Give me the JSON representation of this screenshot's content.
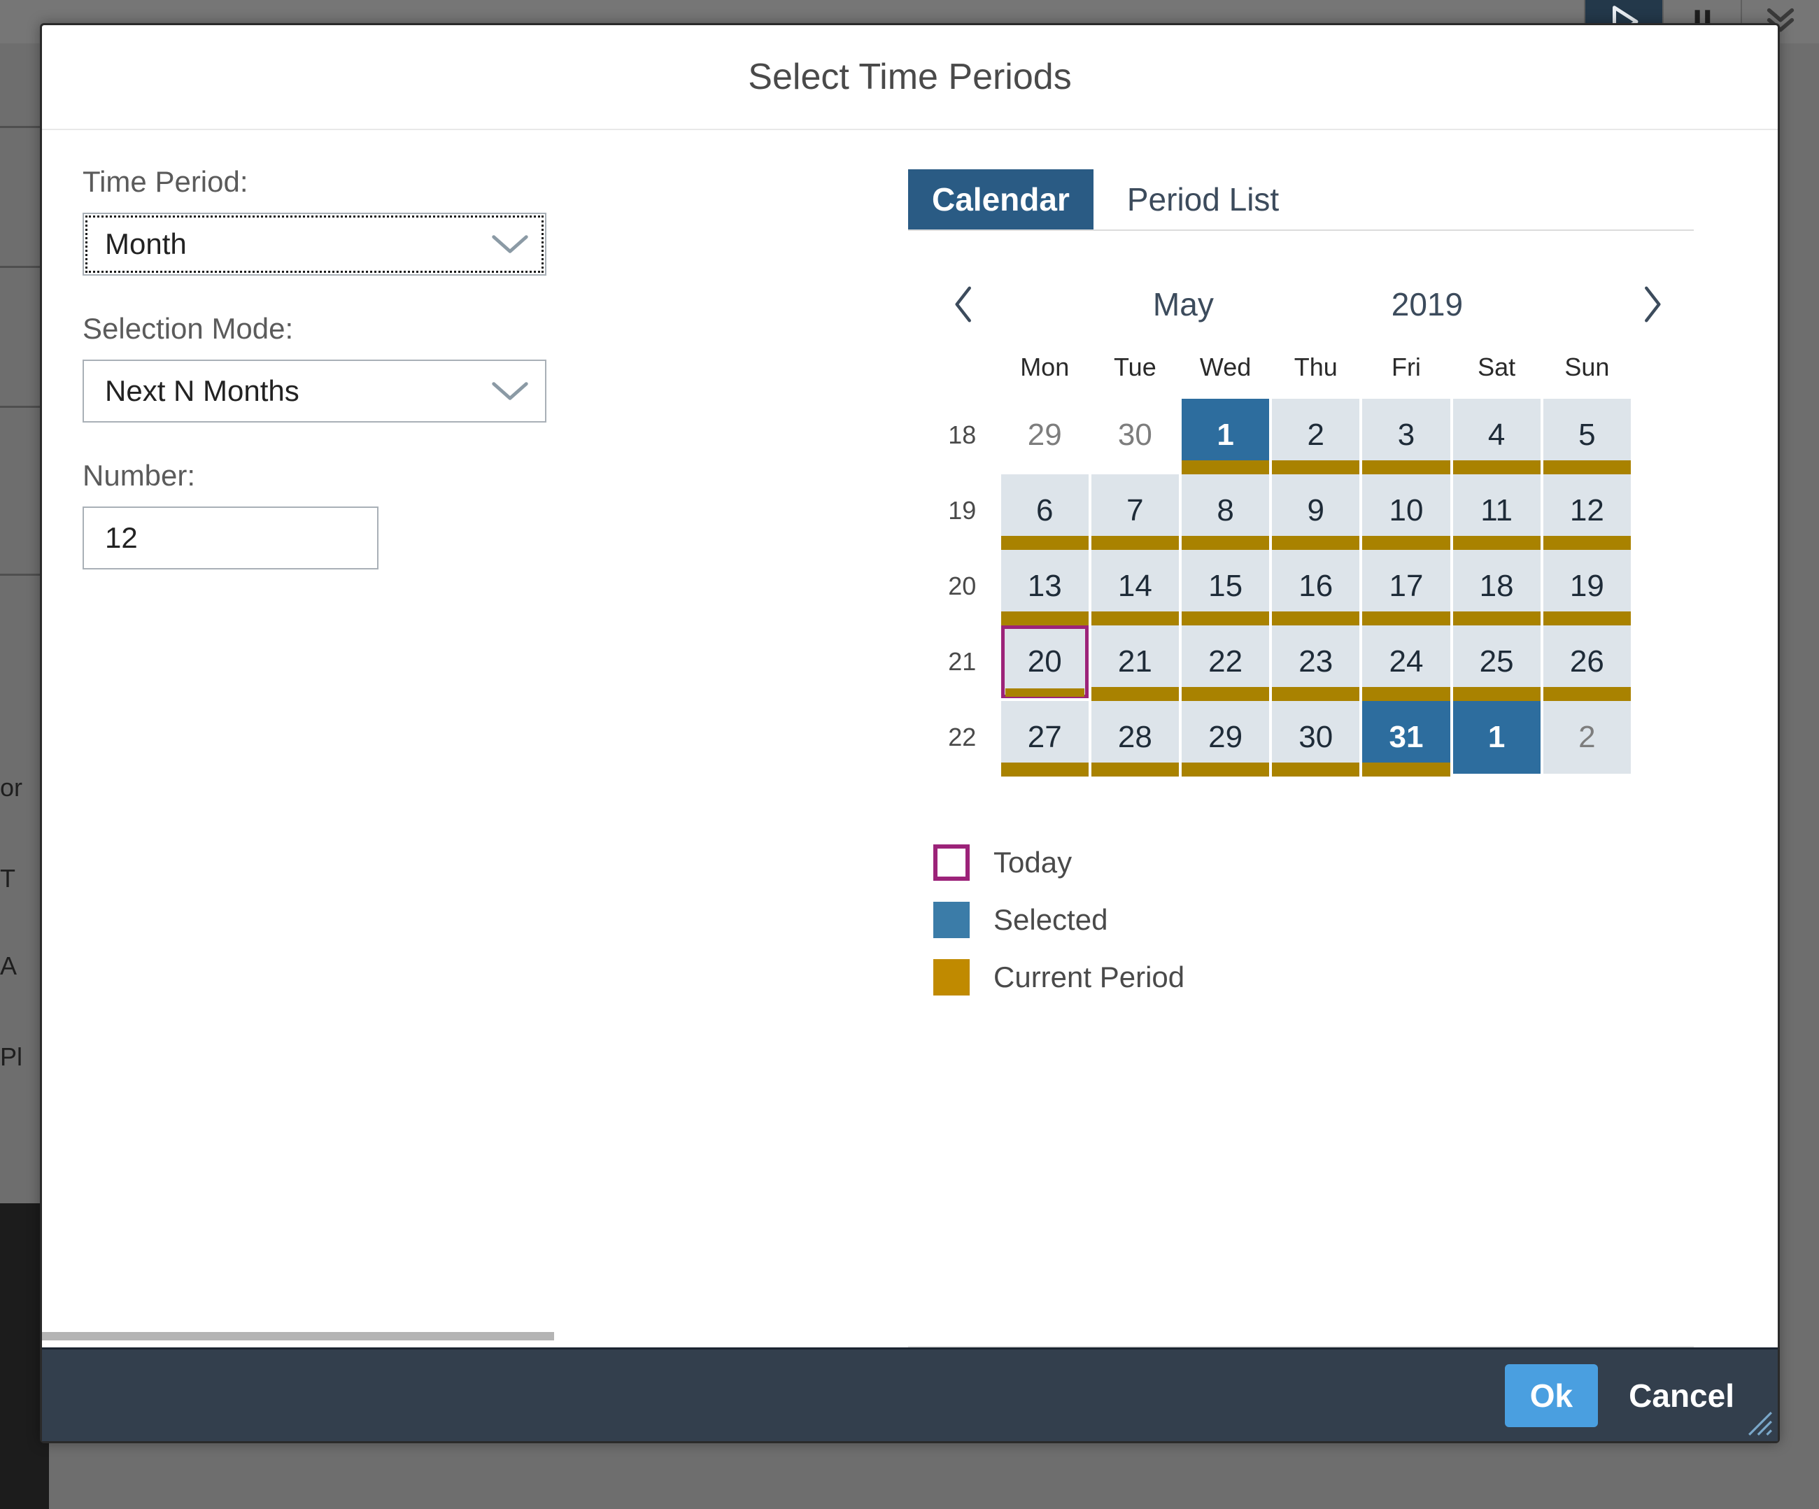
{
  "background": {
    "toolbar_buttons": [
      {
        "name": "play-icon",
        "active": true
      },
      {
        "name": "pause-icon",
        "active": false
      },
      {
        "name": "chevron-double-down-icon",
        "active": false
      }
    ],
    "edge_labels": [
      "or",
      "T",
      "A",
      "Pl"
    ]
  },
  "dialog": {
    "title": "Select Time Periods",
    "form": {
      "time_period": {
        "label": "Time Period:",
        "value": "Month"
      },
      "selection_mode": {
        "label": "Selection Mode:",
        "value": "Next N Months"
      },
      "number": {
        "label": "Number:",
        "value": "12"
      }
    },
    "tabs": [
      {
        "label": "Calendar",
        "active": true
      },
      {
        "label": "Period List",
        "active": false
      }
    ],
    "calendar": {
      "prev_label": "‹",
      "next_label": "›",
      "month": "May",
      "year": "2019",
      "weekday_headers": [
        "Mon",
        "Tue",
        "Wed",
        "Thu",
        "Fri",
        "Sat",
        "Sun"
      ],
      "week_numbers": [
        "18",
        "19",
        "20",
        "21",
        "22"
      ],
      "weeks": [
        {
          "week": "18",
          "days": [
            {
              "label": "29",
              "state": "outside",
              "period": false
            },
            {
              "label": "30",
              "state": "outside",
              "period": false
            },
            {
              "label": "1",
              "state": "selected",
              "period": true
            },
            {
              "label": "2",
              "state": "normal",
              "period": true
            },
            {
              "label": "3",
              "state": "normal",
              "period": true
            },
            {
              "label": "4",
              "state": "normal",
              "period": true
            },
            {
              "label": "5",
              "state": "normal",
              "period": true
            }
          ]
        },
        {
          "week": "19",
          "days": [
            {
              "label": "6",
              "state": "normal",
              "period": true
            },
            {
              "label": "7",
              "state": "normal",
              "period": true
            },
            {
              "label": "8",
              "state": "normal",
              "period": true
            },
            {
              "label": "9",
              "state": "normal",
              "period": true
            },
            {
              "label": "10",
              "state": "normal",
              "period": true
            },
            {
              "label": "11",
              "state": "normal",
              "period": true
            },
            {
              "label": "12",
              "state": "normal",
              "period": true
            }
          ]
        },
        {
          "week": "20",
          "days": [
            {
              "label": "13",
              "state": "normal",
              "period": true
            },
            {
              "label": "14",
              "state": "normal",
              "period": true
            },
            {
              "label": "15",
              "state": "normal",
              "period": true
            },
            {
              "label": "16",
              "state": "normal",
              "period": true
            },
            {
              "label": "17",
              "state": "normal",
              "period": true
            },
            {
              "label": "18",
              "state": "normal",
              "period": true
            },
            {
              "label": "19",
              "state": "normal",
              "period": true
            }
          ]
        },
        {
          "week": "21",
          "days": [
            {
              "label": "20",
              "state": "today",
              "period": true
            },
            {
              "label": "21",
              "state": "normal",
              "period": true
            },
            {
              "label": "22",
              "state": "normal",
              "period": true
            },
            {
              "label": "23",
              "state": "normal",
              "period": true
            },
            {
              "label": "24",
              "state": "normal",
              "period": true
            },
            {
              "label": "25",
              "state": "normal",
              "period": true
            },
            {
              "label": "26",
              "state": "normal",
              "period": true
            }
          ]
        },
        {
          "week": "22",
          "days": [
            {
              "label": "27",
              "state": "normal",
              "period": true
            },
            {
              "label": "28",
              "state": "normal",
              "period": true
            },
            {
              "label": "29",
              "state": "normal",
              "period": true
            },
            {
              "label": "30",
              "state": "normal",
              "period": true
            },
            {
              "label": "31",
              "state": "selected",
              "period": true
            },
            {
              "label": "1",
              "state": "selected",
              "period": false
            },
            {
              "label": "2",
              "state": "other",
              "period": false
            }
          ]
        }
      ]
    },
    "legend": [
      {
        "key": "today",
        "label": "Today",
        "color": "#9c2379"
      },
      {
        "key": "selected",
        "label": "Selected",
        "color": "#3b7ca8"
      },
      {
        "key": "current",
        "label": "Current Period",
        "color": "#c08a00"
      }
    ],
    "footer": {
      "ok_label": "Ok",
      "cancel_label": "Cancel"
    }
  },
  "colors": {
    "selected_blue": "#2d6d9e",
    "current_period_gold": "#a98200",
    "today_magenta": "#9c2379",
    "tab_active_blue": "#2a5b84",
    "footer_dark": "#333f4d",
    "ok_button_blue": "#4a9fe0",
    "day_cell_bg": "#dde4ea"
  }
}
